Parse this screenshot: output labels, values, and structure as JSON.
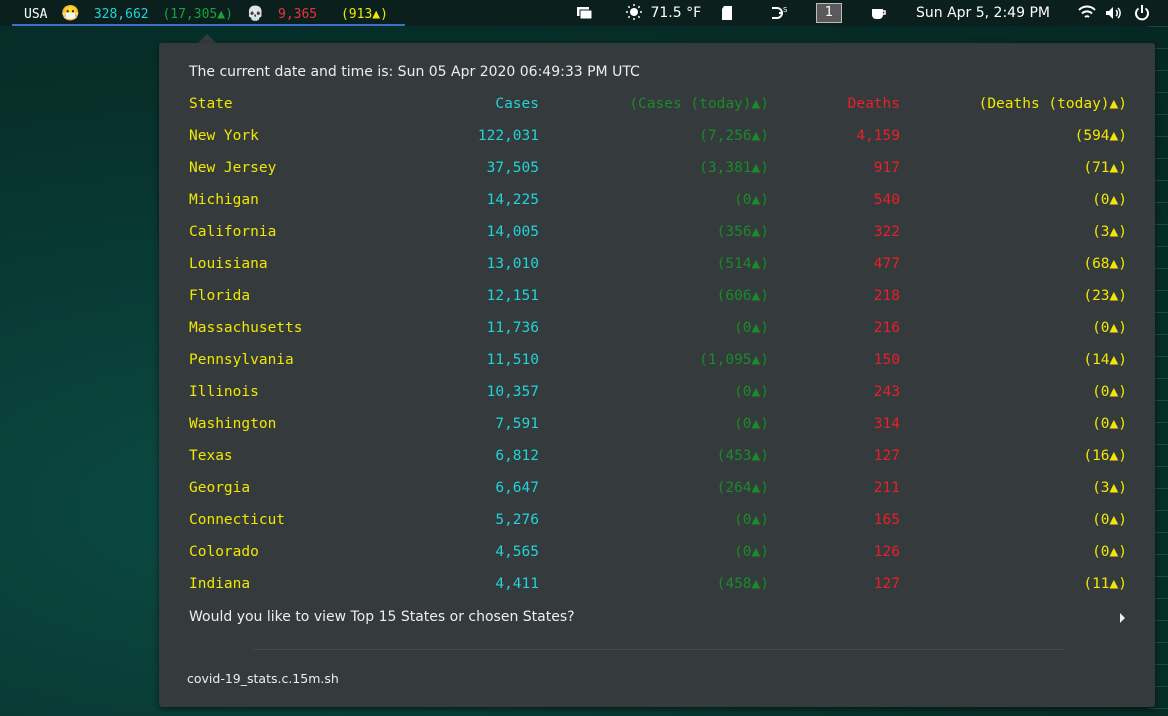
{
  "topbar": {
    "country": "USA",
    "mask_emoji": "😷",
    "cases": "328,662",
    "cases_today": "(17,305▲)",
    "skull_emoji": "💀",
    "deaths": "9,365",
    "deaths_today": "(913▲)",
    "weather_icon": "sun-icon",
    "temperature": "71.5 °F",
    "workspace": "1",
    "clock": "Sun Apr  5,  2:49 PM",
    "icons": [
      "chat-icon",
      "sun-icon",
      "clipboard-icon",
      "vpn-icon",
      "coffee-icon",
      "wifi-icon",
      "volume-icon",
      "power-icon"
    ]
  },
  "popup": {
    "datetime": "The current date and time is: Sun 05 Apr 2020 06:49:33 PM UTC",
    "headers": {
      "state": "State",
      "cases": "Cases",
      "cases_today": "(Cases (today)▲)",
      "deaths": "Deaths",
      "deaths_today": "(Deaths (today)▲)"
    },
    "rows": [
      {
        "state": "New York",
        "cases": "122,031",
        "cases_today": "(7,256▲)",
        "deaths": "4,159",
        "deaths_today": "(594▲)"
      },
      {
        "state": "New Jersey",
        "cases": "37,505",
        "cases_today": "(3,381▲)",
        "deaths": "917",
        "deaths_today": "(71▲)"
      },
      {
        "state": "Michigan",
        "cases": "14,225",
        "cases_today": "(0▲)",
        "deaths": "540",
        "deaths_today": "(0▲)"
      },
      {
        "state": "California",
        "cases": "14,005",
        "cases_today": "(356▲)",
        "deaths": "322",
        "deaths_today": "(3▲)"
      },
      {
        "state": "Louisiana",
        "cases": "13,010",
        "cases_today": "(514▲)",
        "deaths": "477",
        "deaths_today": "(68▲)"
      },
      {
        "state": "Florida",
        "cases": "12,151",
        "cases_today": "(606▲)",
        "deaths": "218",
        "deaths_today": "(23▲)"
      },
      {
        "state": "Massachusetts",
        "cases": "11,736",
        "cases_today": "(0▲)",
        "deaths": "216",
        "deaths_today": "(0▲)"
      },
      {
        "state": "Pennsylvania",
        "cases": "11,510",
        "cases_today": "(1,095▲)",
        "deaths": "150",
        "deaths_today": "(14▲)"
      },
      {
        "state": "Illinois",
        "cases": "10,357",
        "cases_today": "(0▲)",
        "deaths": "243",
        "deaths_today": "(0▲)"
      },
      {
        "state": "Washington",
        "cases": "7,591",
        "cases_today": "(0▲)",
        "deaths": "314",
        "deaths_today": "(0▲)"
      },
      {
        "state": "Texas",
        "cases": "6,812",
        "cases_today": "(453▲)",
        "deaths": "127",
        "deaths_today": "(16▲)"
      },
      {
        "state": "Georgia",
        "cases": "6,647",
        "cases_today": "(264▲)",
        "deaths": "211",
        "deaths_today": "(3▲)"
      },
      {
        "state": "Connecticut",
        "cases": "5,276",
        "cases_today": "(0▲)",
        "deaths": "165",
        "deaths_today": "(0▲)"
      },
      {
        "state": "Colorado",
        "cases": "4,565",
        "cases_today": "(0▲)",
        "deaths": "126",
        "deaths_today": "(0▲)"
      },
      {
        "state": "Indiana",
        "cases": "4,411",
        "cases_today": "(458▲)",
        "deaths": "127",
        "deaths_today": "(11▲)"
      }
    ],
    "question": "Would you like to view Top 15 States or chosen States?",
    "script_name": "covid-19_stats.c.15m.sh"
  }
}
